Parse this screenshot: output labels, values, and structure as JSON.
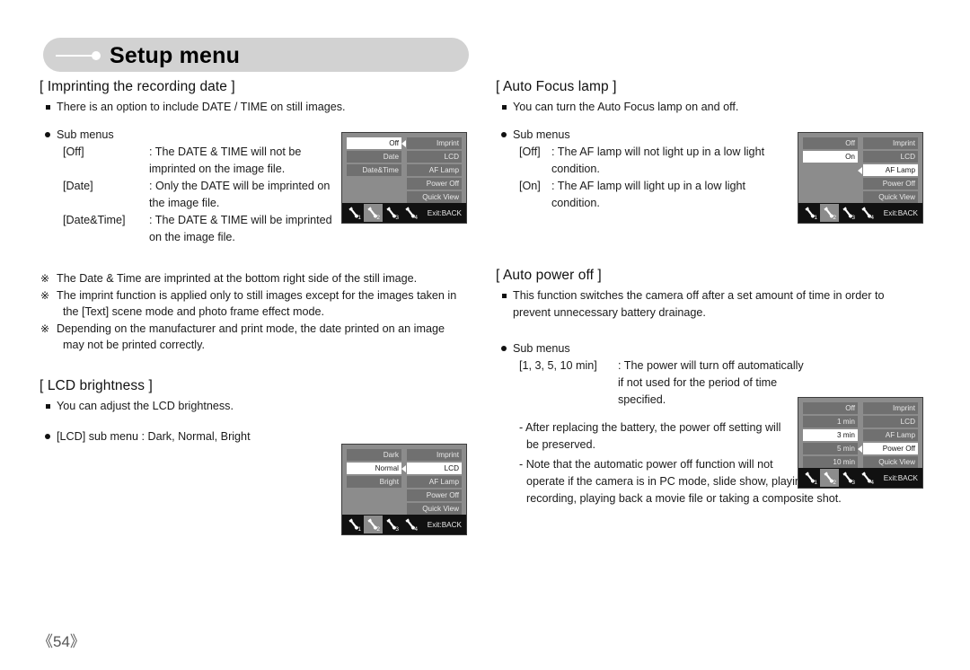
{
  "header": {
    "title": "Setup menu"
  },
  "page_number": "《54》",
  "left": {
    "section1": {
      "title": "[ Imprinting the recording date ]",
      "intro": "There is an option to include DATE / TIME on still images.",
      "submenus_label": "Sub menus",
      "rows": [
        {
          "key": "[Off]",
          "value": ": The DATE & TIME will not be",
          "cont": "imprinted on the image file."
        },
        {
          "key": "[Date]",
          "value": ": Only the DATE will be imprinted on",
          "cont": "the image file."
        },
        {
          "key": "[Date&Time]",
          "value": ": The DATE & TIME will be imprinted",
          "cont": "on the image file."
        }
      ],
      "notes": [
        "The Date & Time are imprinted at the bottom right side of the still image.",
        "The imprint function is applied only to still images except for the images taken in",
        "the [Text] scene mode and photo frame effect mode.",
        "Depending on the manufacturer and print mode, the date printed on an image",
        "may not be printed correctly."
      ]
    },
    "section2": {
      "title": "[ LCD brightness ]",
      "intro": "You can adjust the LCD brightness.",
      "submenu_line": "[LCD] sub menu : Dark, Normal, Bright"
    }
  },
  "right": {
    "section1": {
      "title": "[ Auto Focus lamp ]",
      "intro": "You can turn the Auto Focus lamp on and off.",
      "submenus_label": "Sub menus",
      "rows": [
        {
          "key": "[Off]",
          "value": ": The AF lamp will not light up in a low light",
          "cont": "condition."
        },
        {
          "key": "[On]",
          "value": ": The AF lamp will light up in a low light",
          "cont": "condition."
        }
      ]
    },
    "section2": {
      "title": "[ Auto power off ]",
      "intro_line1": "This function switches the camera off after a set amount of time in order to",
      "intro_line2": "prevent unnecessary battery drainage.",
      "submenus_label": "Sub menus",
      "row": {
        "key": "[1, 3, 5, 10 min]",
        "value": ": The power will turn off automatically",
        "cont1": "if not used for the period of time",
        "cont2": "specified."
      },
      "dashes": [
        {
          "line1": "- After replacing the battery, the power off setting will",
          "line2": "be preserved."
        },
        {
          "line1": "- Note that the automatic power off function will not",
          "line2": "operate if the camera is in PC mode, slide show, playing back a voice",
          "line3": "recording, playing back a movie file or taking a composite shot."
        }
      ]
    }
  },
  "lcd_screens": [
    {
      "id": "imprint-screen",
      "left_items": [
        {
          "label": "Off",
          "selected": true
        },
        {
          "label": "Date",
          "selected": false
        },
        {
          "label": "Date&Time",
          "selected": false
        }
      ],
      "right_items": [
        {
          "label": "Imprint",
          "selected": false
        },
        {
          "label": "LCD",
          "selected": false
        },
        {
          "label": "AF Lamp",
          "selected": false
        },
        {
          "label": "Power Off",
          "selected": false
        },
        {
          "label": "Quick View",
          "selected": false
        }
      ],
      "arrow_row": 0,
      "tabs": [
        {
          "num": "1",
          "active": false
        },
        {
          "num": "2",
          "active": true
        },
        {
          "num": "3",
          "active": false
        },
        {
          "num": "4",
          "active": false
        }
      ],
      "exit_label": "Exit:BACK"
    },
    {
      "id": "lcd-brightness-screen",
      "left_items": [
        {
          "label": "Dark",
          "selected": false
        },
        {
          "label": "Normal",
          "selected": true
        },
        {
          "label": "Bright",
          "selected": false
        }
      ],
      "right_items": [
        {
          "label": "Imprint",
          "selected": false
        },
        {
          "label": "LCD",
          "selected": true
        },
        {
          "label": "AF Lamp",
          "selected": false
        },
        {
          "label": "Power Off",
          "selected": false
        },
        {
          "label": "Quick View",
          "selected": false
        }
      ],
      "arrow_row": 1,
      "tabs": [
        {
          "num": "1",
          "active": false
        },
        {
          "num": "2",
          "active": true
        },
        {
          "num": "3",
          "active": false
        },
        {
          "num": "4",
          "active": false
        }
      ],
      "exit_label": "Exit:BACK"
    },
    {
      "id": "af-lamp-screen",
      "left_items": [
        {
          "label": "Off",
          "selected": false
        },
        {
          "label": "On",
          "selected": true
        }
      ],
      "right_items": [
        {
          "label": "Imprint",
          "selected": false
        },
        {
          "label": "LCD",
          "selected": false
        },
        {
          "label": "AF Lamp",
          "selected": true
        },
        {
          "label": "Power Off",
          "selected": false
        },
        {
          "label": "Quick View",
          "selected": false
        }
      ],
      "arrow_row": 2,
      "tabs": [
        {
          "num": "1",
          "active": false
        },
        {
          "num": "2",
          "active": true
        },
        {
          "num": "3",
          "active": false
        },
        {
          "num": "4",
          "active": false
        }
      ],
      "exit_label": "Exit:BACK"
    },
    {
      "id": "power-off-screen",
      "left_items": [
        {
          "label": "Off",
          "selected": false
        },
        {
          "label": "1 min",
          "selected": false
        },
        {
          "label": "3 min",
          "selected": true
        },
        {
          "label": "5 min",
          "selected": false
        },
        {
          "label": "10 min",
          "selected": false
        }
      ],
      "right_items": [
        {
          "label": "Imprint",
          "selected": false
        },
        {
          "label": "LCD",
          "selected": false
        },
        {
          "label": "AF Lamp",
          "selected": false
        },
        {
          "label": "Power Off",
          "selected": true
        },
        {
          "label": "Quick View",
          "selected": false
        }
      ],
      "arrow_row": 3,
      "tabs": [
        {
          "num": "1",
          "active": false
        },
        {
          "num": "2",
          "active": true
        },
        {
          "num": "3",
          "active": false
        },
        {
          "num": "4",
          "active": false
        }
      ],
      "exit_label": "Exit:BACK"
    }
  ],
  "colors": {
    "header_bg": "#d2d2d2",
    "lcd_bg": "#8c8c8c",
    "lcd_item": "#707070",
    "lcd_selected": "#ffffff",
    "lcd_foot": "#111111"
  }
}
